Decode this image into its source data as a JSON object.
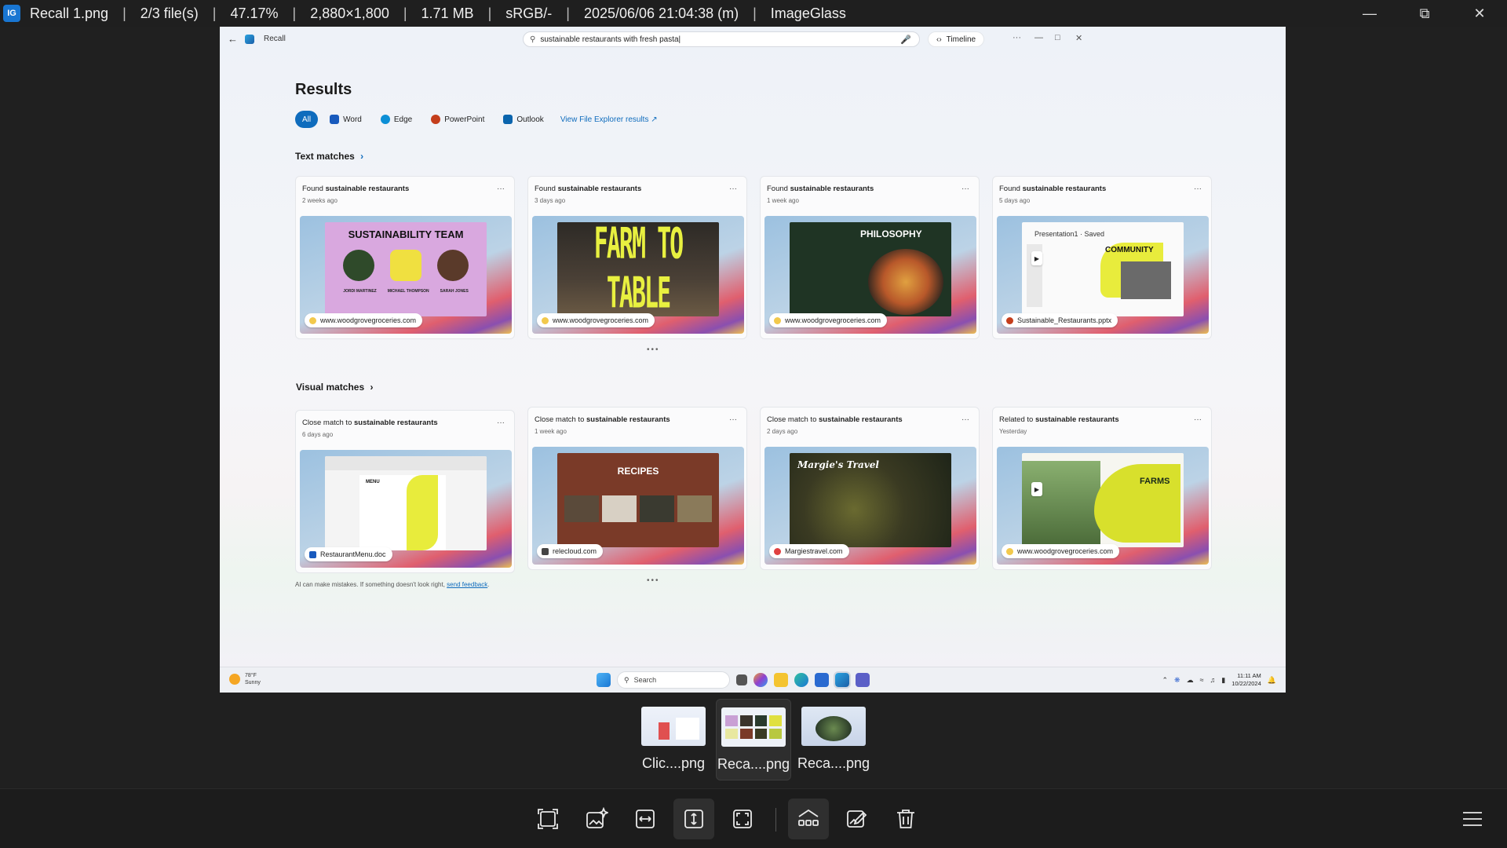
{
  "titlebar": {
    "items": [
      "Recall 1.png",
      "2/3 file(s)",
      "47.17%",
      "2,880×1,800",
      "1.71 MB",
      "sRGB/-",
      "2025/06/06 21:04:38 (m)",
      "ImageGlass"
    ],
    "icon_label": "IG"
  },
  "recall": {
    "app_name": "Recall",
    "search_value": "sustainable restaurants with fresh pasta|",
    "timeline_label": "Timeline",
    "results_title": "Results",
    "filters": [
      "All",
      "Word",
      "Edge",
      "PowerPoint",
      "Outlook"
    ],
    "filter_colors": [
      "#0f6cbd",
      "#185abd",
      "#0c8fd6",
      "#c43e1c",
      "#0a64ad"
    ],
    "explorer_link": "View File Explorer results",
    "text_matches_title": "Text matches",
    "visual_matches_title": "Visual matches",
    "text_cards": [
      {
        "prefix": "Found ",
        "bold": "sustainable restaurants",
        "age": "2 weeks ago",
        "slide_title": "SUSTAINABILITY TEAM",
        "people": [
          "JORDI MARTINEZ",
          "MICHAEL THOMPSON",
          "SARAH JONES"
        ],
        "source": "www.woodgrovegroceries.com",
        "source_color": "#f2c94c"
      },
      {
        "prefix": "Found ",
        "bold": "sustainable restaurants",
        "age": "3 days ago",
        "slide_title": "FARM TO TABLE",
        "source": "www.woodgrovegroceries.com",
        "source_color": "#f2c94c"
      },
      {
        "prefix": "Found ",
        "bold": "sustainable restaurants",
        "age": "1 week ago",
        "slide_title": "PHILOSOPHY",
        "source": "www.woodgrovegroceries.com",
        "source_color": "#f2c94c"
      },
      {
        "prefix": "Found ",
        "bold": "sustainable restaurants",
        "age": "5 days ago",
        "slide_title": "COMMUNITY",
        "doc_title": "Presentation1 · Saved",
        "source": "Sustainable_Restaurants.pptx",
        "source_color": "#c43e1c"
      }
    ],
    "visual_cards": [
      {
        "prefix": "Close match to ",
        "bold": "sustainable restaurants",
        "age": "6 days ago",
        "slide_title": "MENU",
        "source": "RestaurantMenu.doc",
        "source_color": "#185abd"
      },
      {
        "prefix": "Close match to ",
        "bold": "sustainable restaurants",
        "age": "1 week ago",
        "slide_title": "RECIPES",
        "source": "relecloud.com",
        "source_color": "#444444"
      },
      {
        "prefix": "Close match to ",
        "bold": "sustainable restaurants",
        "age": "2 days ago",
        "slide_title": "Margie's Travel",
        "source": "Margiestravel.com",
        "source_color": "#e04040"
      },
      {
        "prefix": "Related to ",
        "bold": "sustainable restaurants",
        "age": "Yesterday",
        "slide_title": "FARMS",
        "source": "www.woodgrovegroceries.com",
        "source_color": "#f2c94c"
      }
    ],
    "disclaimer_text": "AI can make mistakes. If something doesn't look right, ",
    "disclaimer_link": "send feedback",
    "disclaimer_end": "."
  },
  "taskbar": {
    "weather_temp": "78°F",
    "weather_cond": "Sunny",
    "search_label": "Search",
    "time": "11:11 AM",
    "date": "10/22/2024"
  },
  "filmstrip": {
    "items": [
      "Clic....png",
      "Reca....png",
      "Reca....png"
    ],
    "active_index": 1
  },
  "toolbar": {
    "tools": [
      "crop-icon",
      "image-sparkle-icon",
      "fit-width-icon",
      "fit-height-icon",
      "full-screen-icon",
      "gallery-icon",
      "edit-image-icon",
      "delete-icon"
    ],
    "active_tools": [
      "fit-height-icon",
      "gallery-icon"
    ]
  }
}
